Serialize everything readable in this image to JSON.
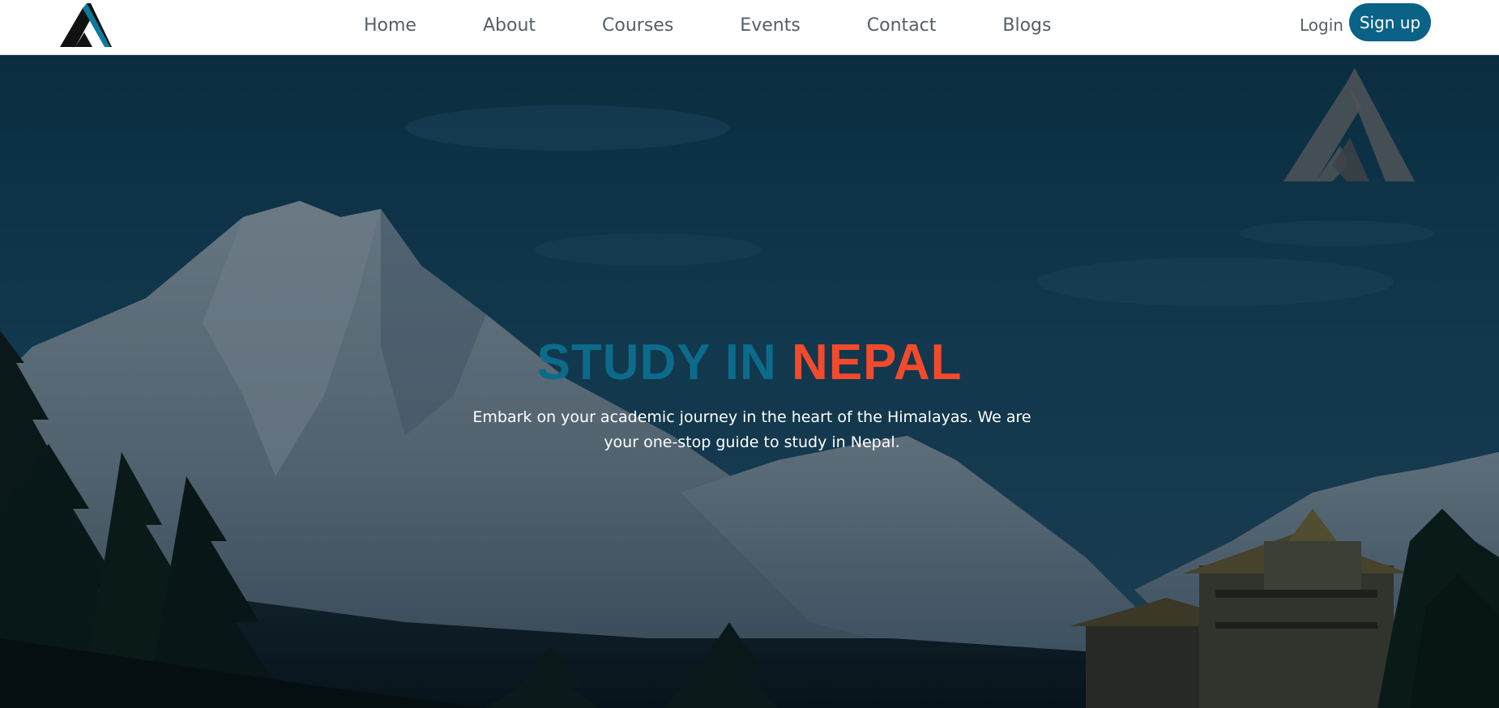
{
  "colors": {
    "accent": "#0a6286",
    "title_blue": "#0c6b8a",
    "title_orange": "#f24a2c",
    "nav_text": "#555f66"
  },
  "header": {
    "logo_icon": "triangle-logo-icon",
    "nav_items": [
      "Home",
      "About",
      "Courses",
      "Events",
      "Contact",
      "Blogs"
    ],
    "login_label": "Login",
    "signup_label": "Sign up"
  },
  "hero": {
    "background": "himalaya-mountain-monastery-photo",
    "title_part_a": "STUDY IN ",
    "title_part_b": "NEPAL",
    "subtitle": "Embark on your academic journey in the heart of the Himalayas. We are your one-stop guide to study in Nepal.",
    "watermark_icon": "triangle-logo-icon"
  }
}
